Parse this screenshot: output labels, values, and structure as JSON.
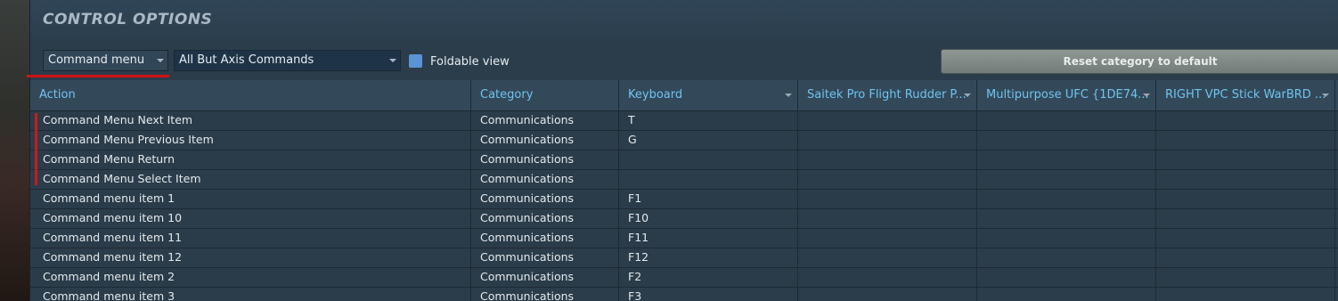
{
  "window": {
    "title": "CONTROL OPTIONS"
  },
  "toolbar": {
    "category_select": {
      "value": "Command menu"
    },
    "filter_select": {
      "value": "All But Axis Commands"
    },
    "foldable_view": {
      "label": "Foldable view",
      "checked": true
    },
    "reset_button": {
      "label": "Reset category to default"
    }
  },
  "table": {
    "headers": {
      "action": "Action",
      "category": "Category",
      "keyboard": "Keyboard",
      "device1": "Saitek Pro Flight Rudder P...",
      "device2": "Multipurpose UFC {1DE74...",
      "device3": "RIGHT VPC Stick WarBRD ..."
    },
    "rows": [
      {
        "action": "Command Menu Next Item",
        "category": "Communications",
        "keyboard": "T"
      },
      {
        "action": "Command Menu Previous Item",
        "category": "Communications",
        "keyboard": "G"
      },
      {
        "action": "Command Menu Return",
        "category": "Communications",
        "keyboard": ""
      },
      {
        "action": "Command Menu Select Item",
        "category": "Communications",
        "keyboard": ""
      },
      {
        "action": "Command menu item 1",
        "category": "Communications",
        "keyboard": "F1"
      },
      {
        "action": "Command menu item 10",
        "category": "Communications",
        "keyboard": "F10"
      },
      {
        "action": "Command menu item 11",
        "category": "Communications",
        "keyboard": "F11"
      },
      {
        "action": "Command menu item 12",
        "category": "Communications",
        "keyboard": "F12"
      },
      {
        "action": "Command menu item 2",
        "category": "Communications",
        "keyboard": "F2"
      },
      {
        "action": "Command menu item 3",
        "category": "Communications",
        "keyboard": "F3"
      }
    ]
  },
  "colors": {
    "header_text": "#6fc3ef",
    "annotation_red": "#d01414",
    "checkbox_blue": "#5b94d6"
  }
}
